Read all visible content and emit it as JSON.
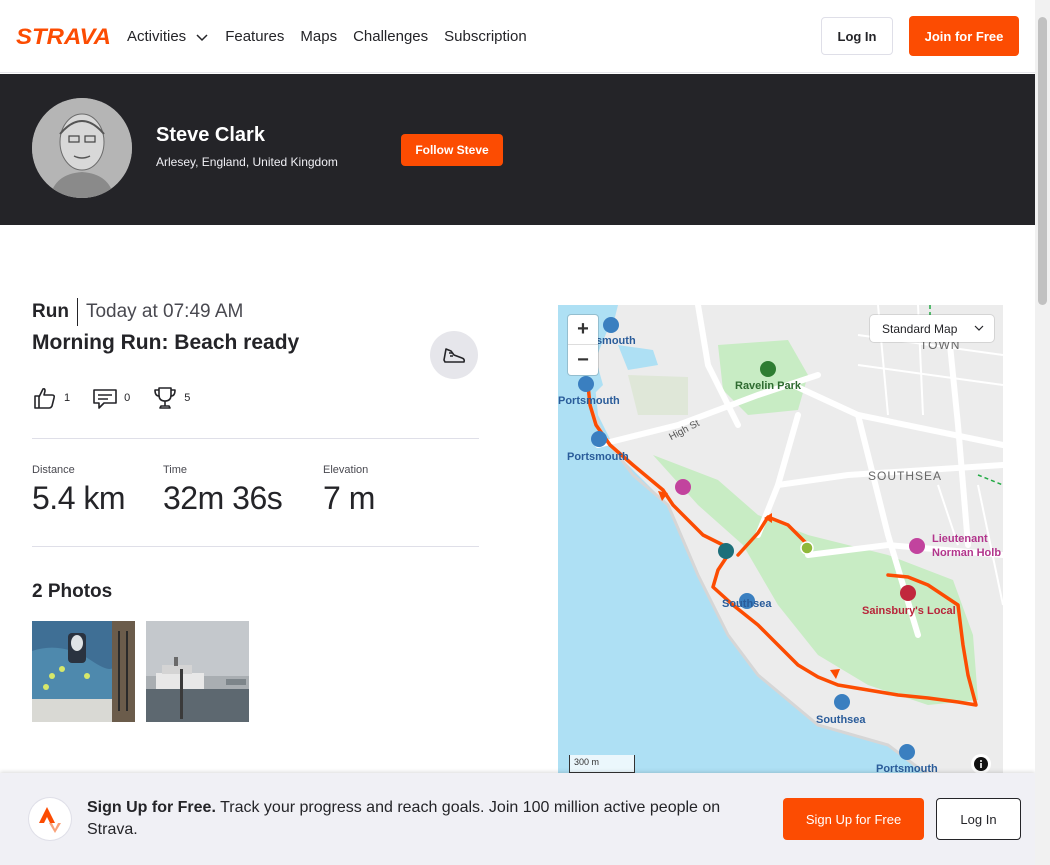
{
  "header": {
    "logo_text": "STRAVA",
    "nav": [
      {
        "label": "Activities",
        "has_dropdown": true
      },
      {
        "label": "Features",
        "has_dropdown": false
      },
      {
        "label": "Maps",
        "has_dropdown": false
      },
      {
        "label": "Challenges",
        "has_dropdown": false
      },
      {
        "label": "Subscription",
        "has_dropdown": false
      }
    ],
    "login_label": "Log In",
    "join_label": "Join for Free"
  },
  "athlete": {
    "name": "Steve Clark",
    "location": "Arlesey, England, United Kingdom",
    "follow_label": "Follow Steve"
  },
  "activity": {
    "type": "Run",
    "time": "Today at 07:49 AM",
    "title": "Morning Run: Beach ready",
    "kudos_count": "1",
    "comments_count": "0",
    "achievements_count": "5",
    "stats": [
      {
        "label": "Distance",
        "value": "5.4 km"
      },
      {
        "label": "Time",
        "value": "32m 36s"
      },
      {
        "label": "Elevation",
        "value": "7 m"
      }
    ],
    "photos_title": "2 Photos"
  },
  "map": {
    "map_type": "Standard Map",
    "zoom_in": "+",
    "zoom_out": "−",
    "scale_label": "300 m",
    "labels": {
      "portsmouth_1": "rtsmouth",
      "portsmouth_2": "Portsmouth",
      "portsmouth_3": "Portsmouth",
      "portsmouth_4": "Portsmouth",
      "ravelin_park": "Ravelin Park",
      "high_st": "High St",
      "town": "TOWN",
      "southsea_district": "SOUTHSEA",
      "southsea_1": "Southsea",
      "southsea_2": "Southsea",
      "lieutenant": "Lieutenant",
      "norman": "Norman Holb",
      "sainsburys": "Sainsbury's Local"
    }
  },
  "signup_bar": {
    "bold": "Sign Up for Free.",
    "text": "Track your progress and reach goals. Join 100 million active people on Strava.",
    "signup_label": "Sign Up for Free",
    "login_label": "Log In"
  },
  "colors": {
    "brand": "#fc4c02",
    "banner": "#242428",
    "route": "#fc4c02"
  }
}
